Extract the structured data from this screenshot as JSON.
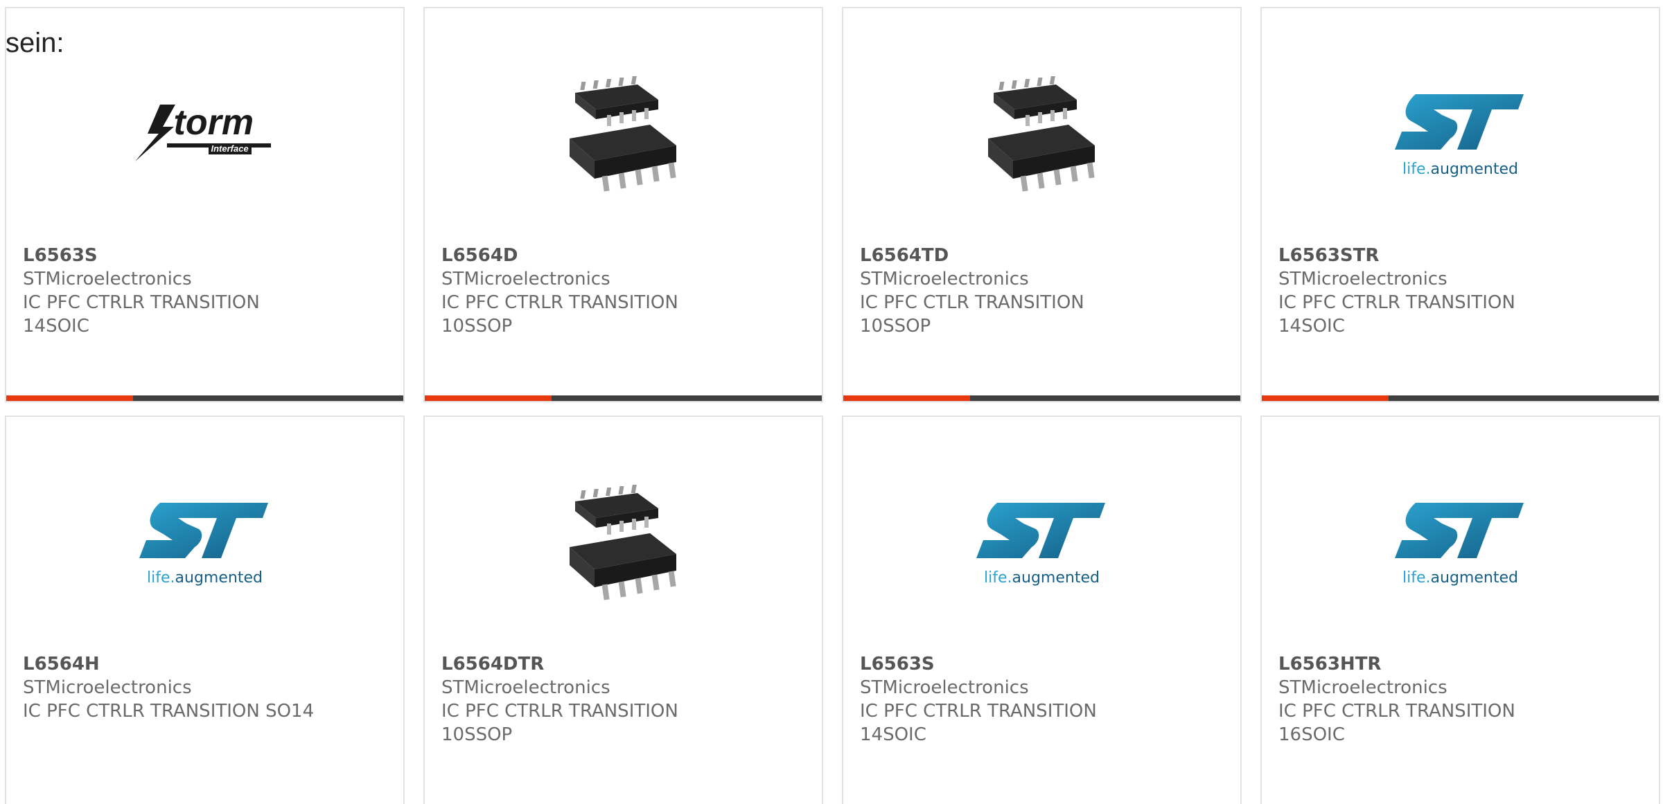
{
  "heading": "sein:",
  "brand_colors": {
    "accent": "#e8380d",
    "bar": "#3f3f3f",
    "st_blue": "#1d8bb8",
    "text": "#6a6a6a"
  },
  "products": [
    {
      "part": "L6563S",
      "manufacturer": "STMicroelectronics",
      "desc1": "IC PFC CTRLR TRANSITION",
      "desc2": "14SOIC",
      "image": "storm-logo",
      "storm_title": "torm",
      "storm_sub": "Interface"
    },
    {
      "part": "L6564D",
      "manufacturer": "STMicroelectronics",
      "desc1": "IC PFC CTRLR TRANSITION",
      "desc2": "10SSOP",
      "image": "ic-chip"
    },
    {
      "part": "L6564TD",
      "manufacturer": "STMicroelectronics",
      "desc1": "IC PFC CTLR TRANSITION",
      "desc2": "10SSOP",
      "image": "ic-chip"
    },
    {
      "part": "L6563STR",
      "manufacturer": "STMicroelectronics",
      "desc1": "IC PFC CTRLR TRANSITION",
      "desc2": "14SOIC",
      "image": "st-logo",
      "tagline_a": "life.",
      "tagline_b": "augmented"
    },
    {
      "part": "L6564H",
      "manufacturer": "STMicroelectronics",
      "desc1": "IC PFC CTRLR TRANSITION SO14",
      "desc2": "",
      "image": "st-logo",
      "tagline_a": "life.",
      "tagline_b": "augmented"
    },
    {
      "part": "L6564DTR",
      "manufacturer": "STMicroelectronics",
      "desc1": "IC PFC CTRLR TRANSITION",
      "desc2": "10SSOP",
      "image": "ic-chip"
    },
    {
      "part": "L6563S",
      "manufacturer": "STMicroelectronics",
      "desc1": "IC PFC CTRLR TRANSITION",
      "desc2": "14SOIC",
      "image": "st-logo",
      "tagline_a": "life.",
      "tagline_b": "augmented"
    },
    {
      "part": "L6563HTR",
      "manufacturer": "STMicroelectronics",
      "desc1": "IC PFC CTRLR TRANSITION",
      "desc2": "16SOIC",
      "image": "st-logo",
      "tagline_a": "life.",
      "tagline_b": "augmented"
    }
  ]
}
